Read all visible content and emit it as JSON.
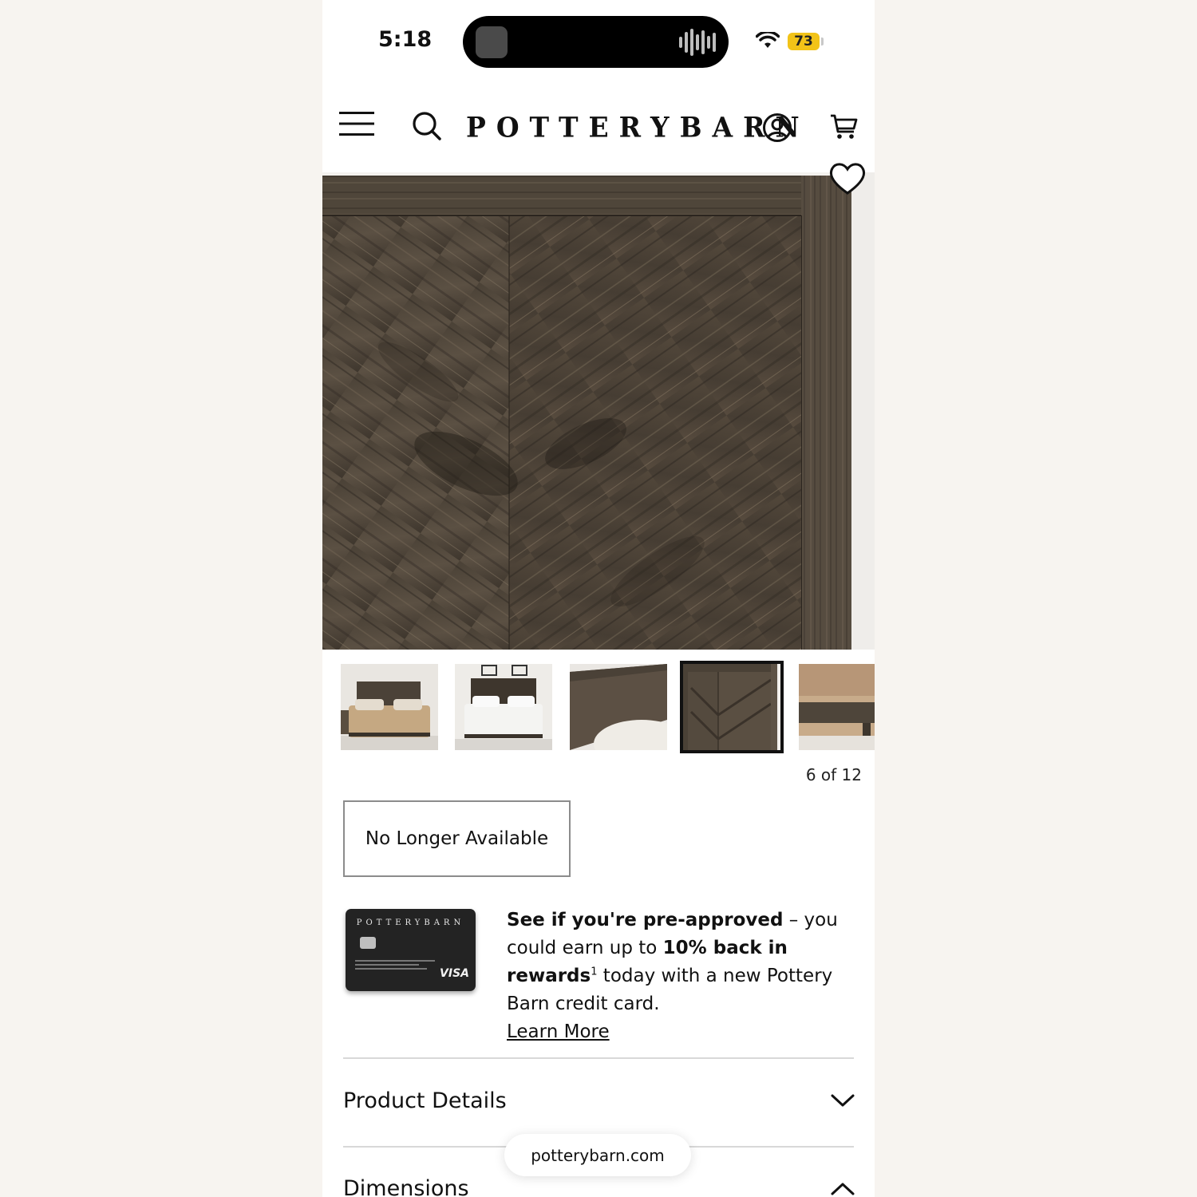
{
  "status_bar": {
    "time": "5:18",
    "battery": "73"
  },
  "header": {
    "brand": "POTTERYBARN"
  },
  "gallery": {
    "counter": "6 of 12",
    "selected_index": 3
  },
  "availability": {
    "label": "No Longer Available"
  },
  "credit_card": {
    "card_brand": "POTTERYBARN",
    "card_network": "VISA",
    "promo_bold_1": "See if you're pre-approved",
    "promo_text_1": " – you could earn up to ",
    "promo_bold_2": "10% back in rewards",
    "promo_sup": "1",
    "promo_text_2": " today with a new Pottery Barn credit card.",
    "learn_more": "Learn More"
  },
  "accordions": [
    {
      "title": "Product Details",
      "state": "collapsed"
    },
    {
      "title": "Dimensions",
      "state": "expanded"
    }
  ],
  "browser": {
    "url": "potterybarn.com"
  },
  "colors": {
    "battery": "#f2c318",
    "wood_dark": "#3b342c",
    "wood_light": "#6e6253"
  }
}
